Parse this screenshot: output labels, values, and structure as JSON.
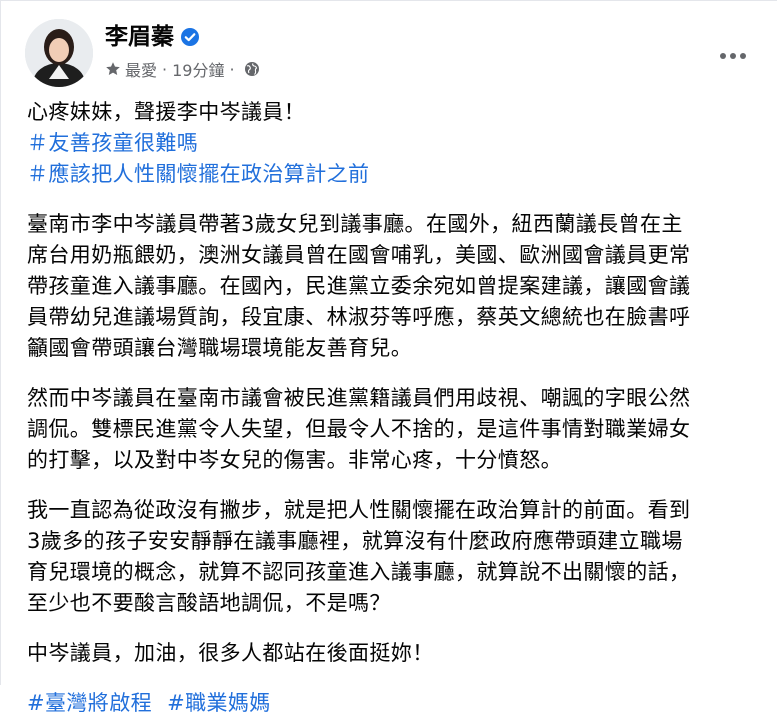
{
  "post": {
    "author": "李眉蓁",
    "meta_favorite": "最愛",
    "meta_time": "19分鐘",
    "meta_dot": "·",
    "headline": "心疼妹妹，聲援李中岑議員！",
    "hashtags_top": [
      "＃友善孩童很難嗎",
      "＃應該把人性關懷擺在政治算計之前"
    ],
    "paragraph_1": [
      "臺南市李中岑議員帶著3歲女兒到議事廳。在國外，紐西蘭議長曾在主",
      "席台用奶瓶餵奶，澳洲女議員曾在國會哺乳，美國、歐洲國會議員更常",
      "帶孩童進入議事廳。在國內，民進黨立委余宛如曾提案建議，讓國會議",
      "員帶幼兒進議場質詢，段宜康、林淑芬等呼應，蔡英文總統也在臉書呼",
      "籲國會帶頭讓台灣職場環境能友善育兒。"
    ],
    "paragraph_2": [
      "然而中岑議員在臺南市議會被民進黨籍議員們用歧視、嘲諷的字眼公然",
      "調侃。雙標民進黨令人失望，但最令人不捨的，是這件事情對職業婦女",
      "的打擊，以及對中岑女兒的傷害。非常心疼，十分憤怒。"
    ],
    "paragraph_3": [
      "我一直認為從政沒有撇步，就是把人性關懷擺在政治算計的前面。看到",
      "3歲多的孩子安安靜靜在議事廳裡，就算沒有什麼政府應帶頭建立職場",
      "育兒環境的概念，就算不認同孩童進入議事廳，就算說不出關懷的話，",
      "至少也不要酸言酸語地調侃，不是嗎？"
    ],
    "paragraph_4": "中岑議員，加油，很多人都站在後面挺妳！",
    "hashtags_bottom": [
      "#臺灣將啟程",
      "#職業媽媽"
    ]
  },
  "colors": {
    "link": "#216fdb",
    "secondary": "#65676b",
    "verified": "#1b74e4"
  },
  "icons": {
    "verified": "verified-badge-icon",
    "favorite": "star-icon",
    "audience": "globe-icon",
    "more": "more-dots-icon"
  }
}
